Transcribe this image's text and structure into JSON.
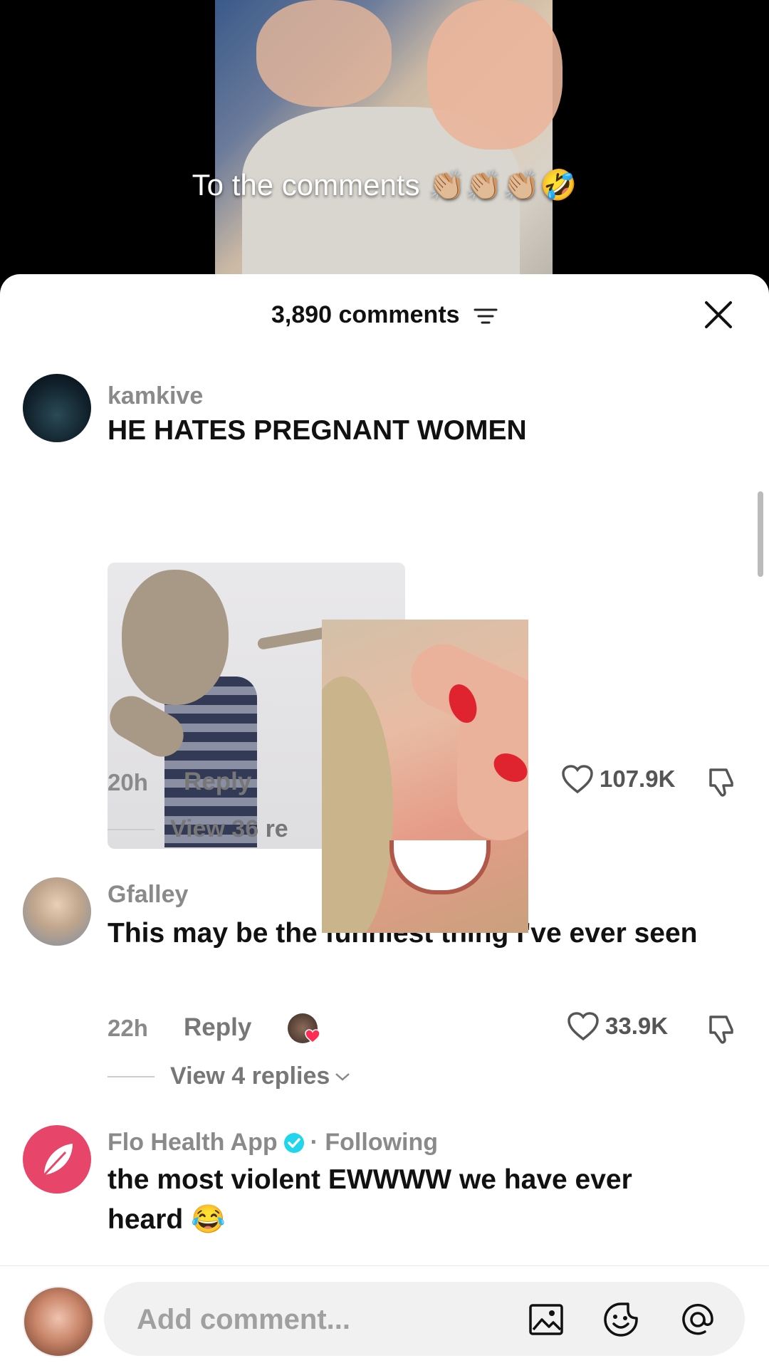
{
  "video": {
    "caption": "To the comments 👏🏼👏🏼👏🏼🤣"
  },
  "header": {
    "comment_count": "3,890 comments"
  },
  "comments": [
    {
      "username": "kamkive",
      "text": "HE HATES PREGNANT WOMEN",
      "time": "20h",
      "reply_label": "Reply",
      "likes": "107.9K",
      "view_replies": "View 36 re"
    },
    {
      "username": "Gfalley",
      "text": "This may be the funniest thing I've ever seen",
      "time": "22h",
      "reply_label": "Reply",
      "likes": "33.9K",
      "view_replies": "View 4 replies"
    },
    {
      "username": "Flo Health App",
      "badge": "· Following",
      "text": "the most violent EWWWW we have ever heard 😂"
    }
  ],
  "input": {
    "placeholder": "Add comment..."
  },
  "colors": {
    "accent": "#e8456a",
    "verified": "#20d5ec",
    "like_heart": "#ff2d55"
  }
}
